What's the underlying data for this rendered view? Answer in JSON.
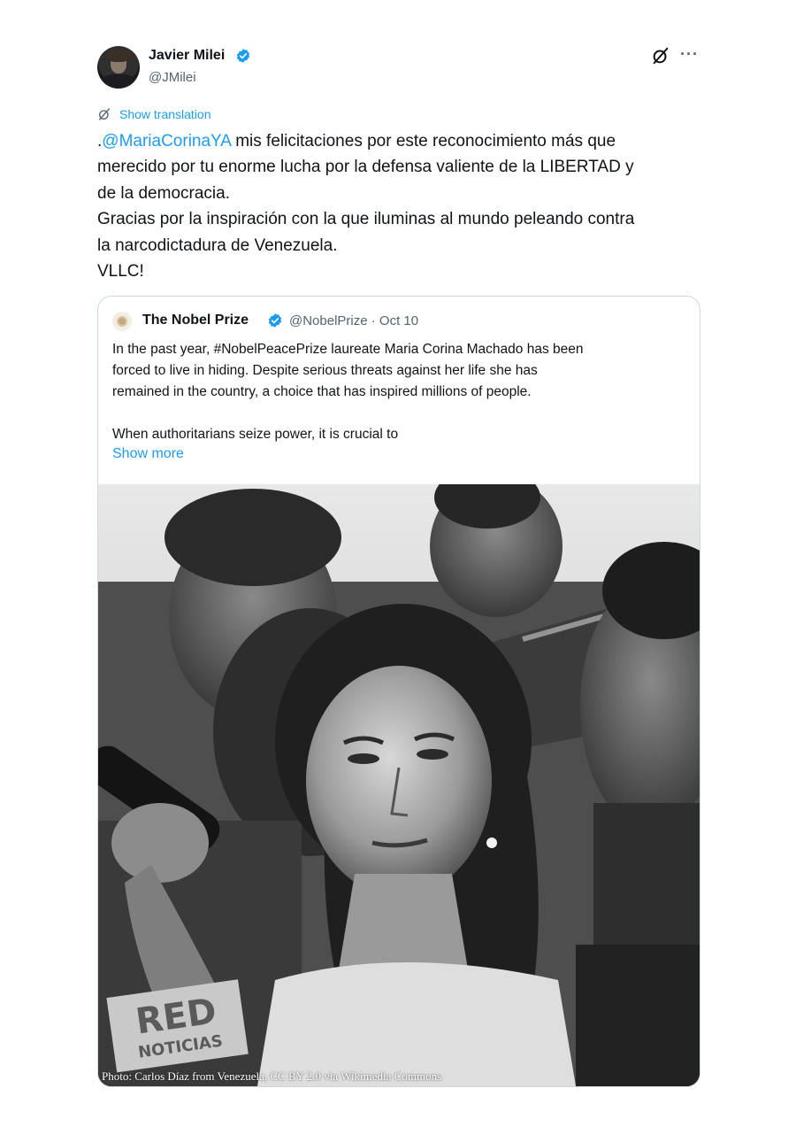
{
  "tweet": {
    "author_name": "Javier Milei",
    "author_handle": "@JMilei",
    "translate_label": "Show translation",
    "body": {
      "lead": ".",
      "mention": "@MariaCorinaYA",
      "line1_rest": " mis felicitaciones por este reconocimiento más que",
      "line2": "merecido por tu enorme lucha por la defensa valiente de la LIBERTAD y",
      "line3": "de la democracia.",
      "line4": "Gracias por la inspiración con la que iluminas al mundo peleando contra",
      "line5": "la narcodictadura de Venezuela.",
      "line6": "VLLC!"
    },
    "icons": [
      "avatar",
      "verified-badge-icon",
      "grok-icon",
      "more-icon",
      "translate-icon"
    ]
  },
  "quote": {
    "author_name": "The Nobel Prize",
    "author_handle": "@NobelPrize · Oct 10",
    "text_lines": [
      "In the past year, #NobelPeacePrize laureate Maria Corina Machado has been",
      "forced to live in hiding. Despite serious threats against her life she has",
      "remained in the country, a choice that has inspired millions of people.",
      "",
      "When authoritarians seize power, it is crucial to"
    ],
    "show_more": "Show more",
    "photo": {
      "sign_line1": "RED",
      "sign_line2": "NOTICIAS",
      "credit": "Photo: Carlos Díaz from Venezuela, CC BY 2.0 via Wikimedia Commons"
    }
  },
  "colors": {
    "link": "#1d9bf0",
    "verified": "#1d9bf0",
    "text": "#0f1419",
    "secondary": "#536471",
    "border": "#cfd9de"
  }
}
